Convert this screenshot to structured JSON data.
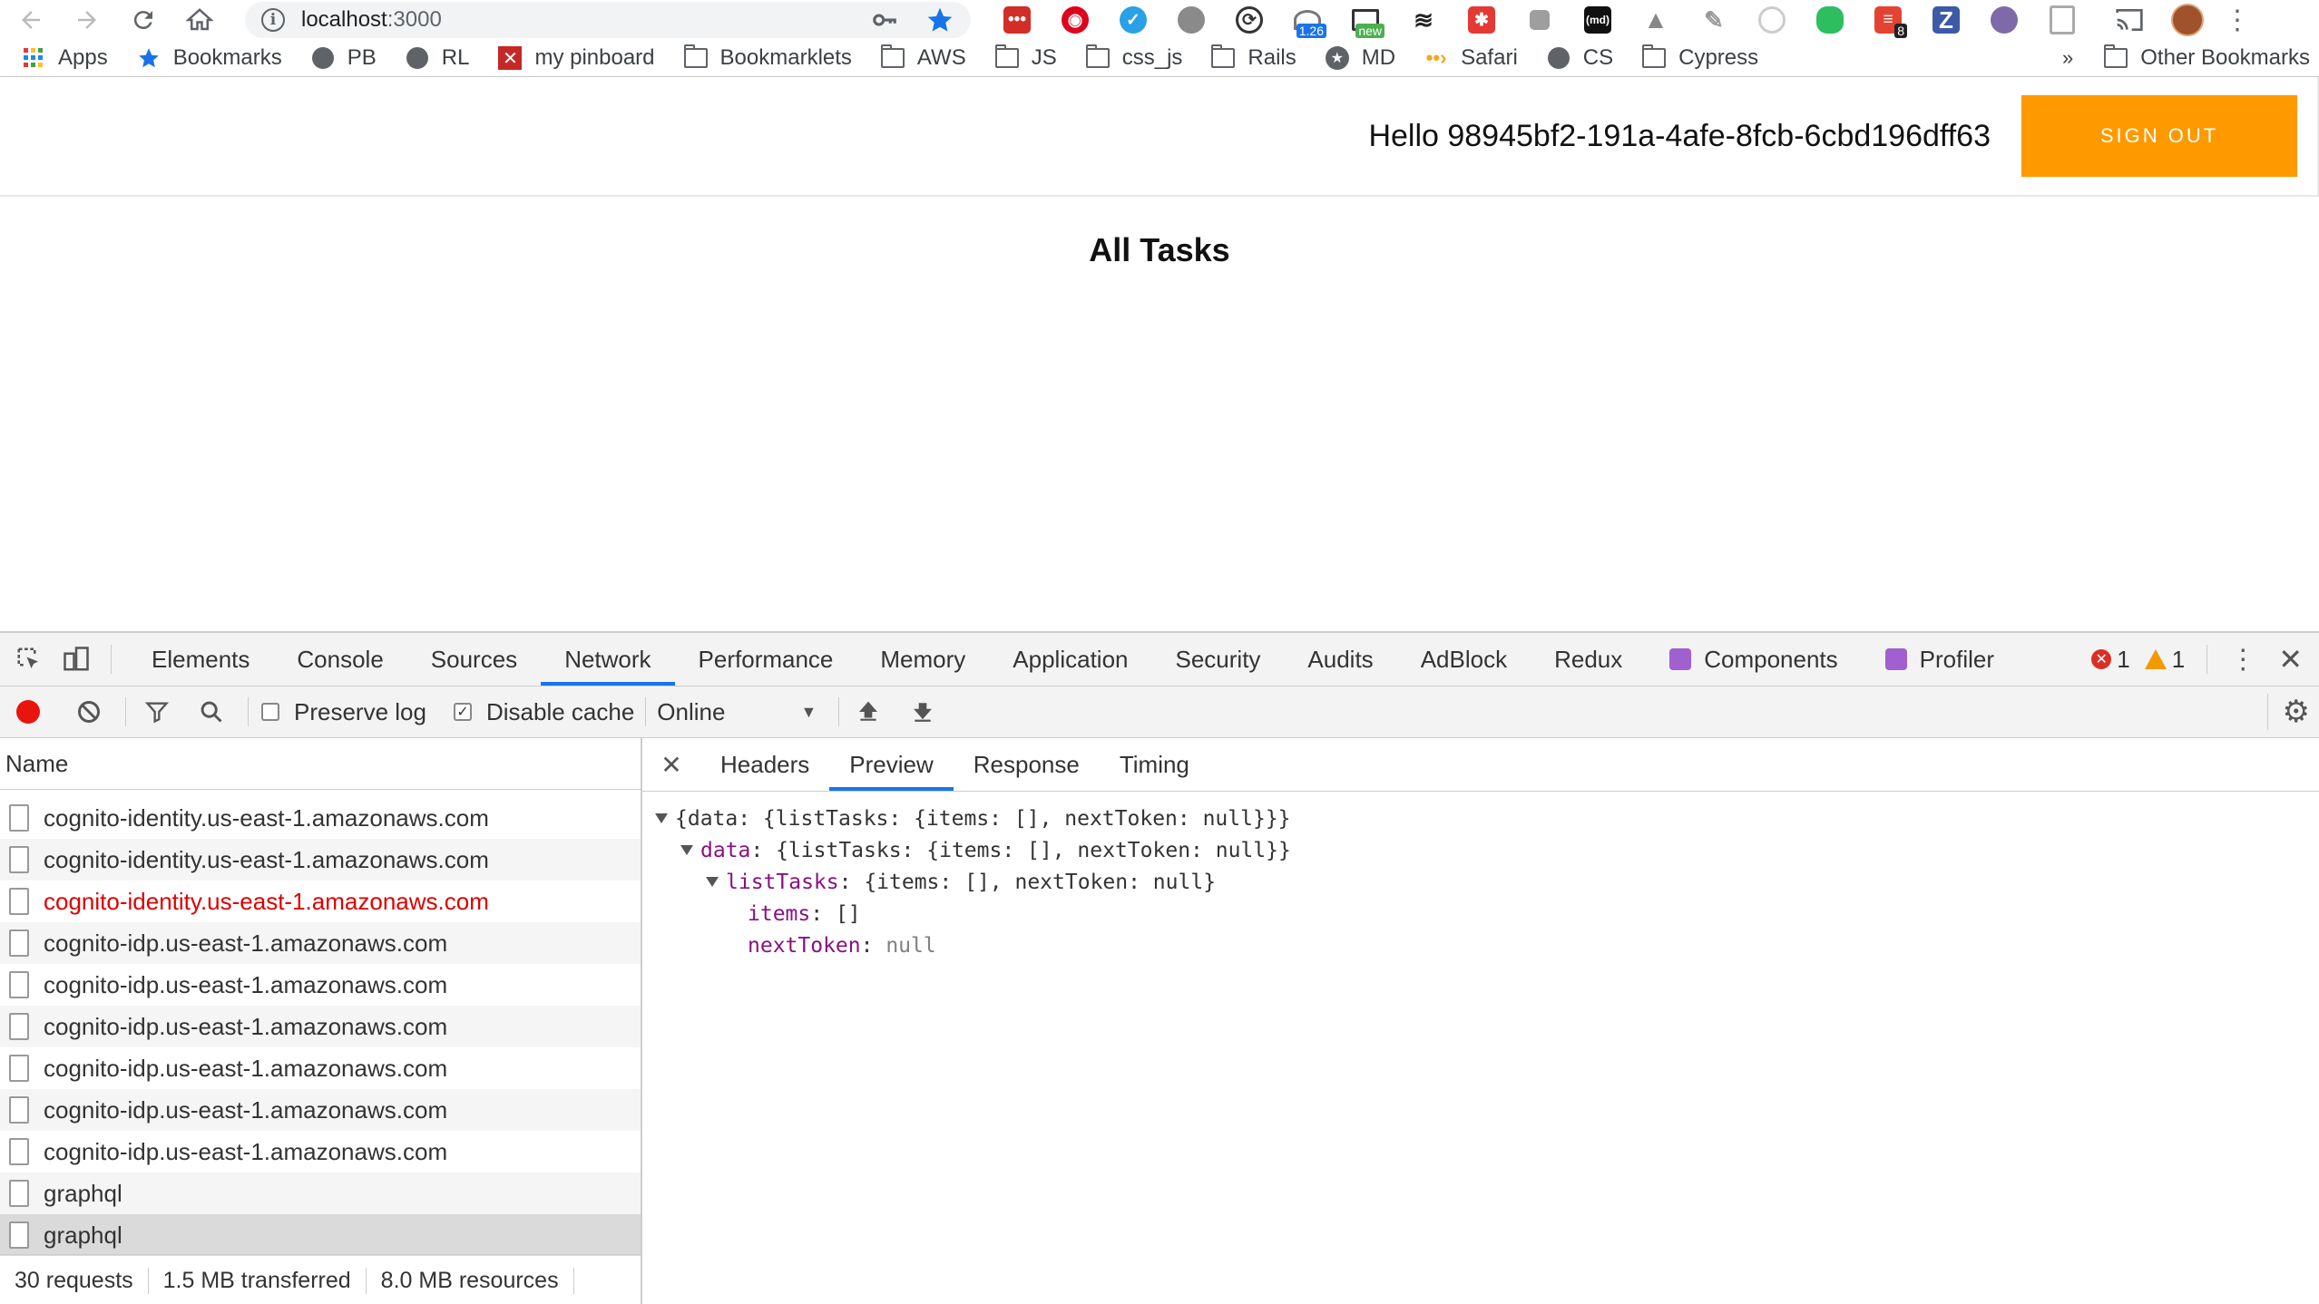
{
  "browser": {
    "url_host": "localhost",
    "url_port": ":3000",
    "extension_badges": {
      "speed": "1.26",
      "new": "new",
      "count": "8"
    },
    "bookmarks": [
      {
        "label": "Apps",
        "icon": "apps-grid-icon"
      },
      {
        "label": "Bookmarks",
        "icon": "star-icon"
      },
      {
        "label": "PB",
        "icon": "globe-icon"
      },
      {
        "label": "RL",
        "icon": "globe-icon"
      },
      {
        "label": "my pinboard",
        "icon": "pinboard-icon"
      },
      {
        "label": "Bookmarklets",
        "icon": "folder-icon"
      },
      {
        "label": "AWS",
        "icon": "folder-icon"
      },
      {
        "label": "JS",
        "icon": "folder-icon"
      },
      {
        "label": "css_js",
        "icon": "folder-icon"
      },
      {
        "label": "Rails",
        "icon": "folder-icon"
      },
      {
        "label": "MD",
        "icon": "star-circle-icon"
      },
      {
        "label": "Safari",
        "icon": "arrow-dots-icon"
      },
      {
        "label": "CS",
        "icon": "globe-icon"
      },
      {
        "label": "Cypress",
        "icon": "folder-icon"
      }
    ],
    "overflow_label": "»",
    "other_bookmarks": "Other Bookmarks"
  },
  "app": {
    "greeting": "Hello 98945bf2-191a-4afe-8fcb-6cbd196dff63",
    "sign_out_label": "SIGN OUT",
    "title": "All Tasks",
    "accent_color": "#ff9900"
  },
  "devtools": {
    "tabs": [
      "Elements",
      "Console",
      "Sources",
      "Network",
      "Performance",
      "Memory",
      "Application",
      "Security",
      "Audits",
      "AdBlock",
      "Redux",
      "Components",
      "Profiler"
    ],
    "active_tab": "Network",
    "error_count": "1",
    "warning_count": "1",
    "toolbar": {
      "preserve_log": "Preserve log",
      "disable_cache": "Disable cache",
      "throttle": "Online"
    },
    "name_header": "Name",
    "requests": [
      {
        "name": "cognito-identity.us-east-1.amazonaws.com",
        "state": "normal"
      },
      {
        "name": "cognito-identity.us-east-1.amazonaws.com",
        "state": "normal"
      },
      {
        "name": "cognito-identity.us-east-1.amazonaws.com",
        "state": "error"
      },
      {
        "name": "cognito-idp.us-east-1.amazonaws.com",
        "state": "normal"
      },
      {
        "name": "cognito-idp.us-east-1.amazonaws.com",
        "state": "normal"
      },
      {
        "name": "cognito-idp.us-east-1.amazonaws.com",
        "state": "normal"
      },
      {
        "name": "cognito-idp.us-east-1.amazonaws.com",
        "state": "normal"
      },
      {
        "name": "cognito-idp.us-east-1.amazonaws.com",
        "state": "normal"
      },
      {
        "name": "cognito-idp.us-east-1.amazonaws.com",
        "state": "normal"
      },
      {
        "name": "graphql",
        "state": "normal"
      },
      {
        "name": "graphql",
        "state": "selected"
      }
    ],
    "status": {
      "requests": "30 requests",
      "transferred": "1.5 MB transferred",
      "resources": "8.0 MB resources"
    },
    "detail_tabs": [
      "Headers",
      "Preview",
      "Response",
      "Timing"
    ],
    "active_detail_tab": "Preview",
    "preview": {
      "line1": "{data: {listTasks: {items: [], nextToken: null}}}",
      "line2_key": "data",
      "line2_val": ": {listTasks: {items: [], nextToken: null}}",
      "line3_key": "listTasks",
      "line3_val": ": {items: [], nextToken: null}",
      "line4_key": "items",
      "line4_val": ": []",
      "line5_key": "nextToken",
      "line5_val": "null"
    }
  }
}
